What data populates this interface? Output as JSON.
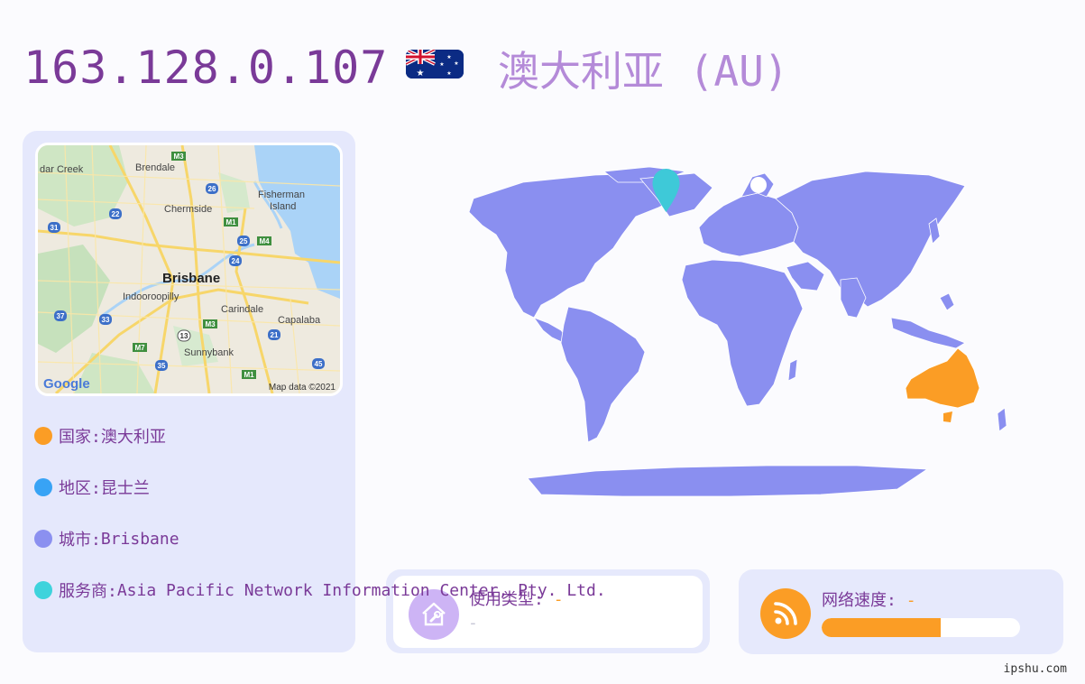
{
  "header": {
    "ip": "163.128.0.107",
    "country_title": "澳大利亚 (AU)"
  },
  "info": {
    "country": {
      "label": "国家: ",
      "value": "澳大利亚",
      "color": "#fb9d25"
    },
    "region": {
      "label": "地区: ",
      "value": "昆士兰",
      "color": "#38a3f5"
    },
    "city": {
      "label": "城市: ",
      "value": "Brisbane",
      "color": "#8b90f0"
    },
    "isp": {
      "label": "服务商: ",
      "value": "Asia Pacific Network Information Center, Pty. Ltd.",
      "color": "#3ed3dc"
    }
  },
  "map": {
    "places": [
      "dar Creek",
      "Brendale",
      "Fisherman",
      "Island",
      "Chermside",
      "Brisbane",
      "Indooroopilly",
      "Carindale",
      "Capalaba",
      "Sunnybank"
    ],
    "road_labels": [
      "M3",
      "26",
      "22",
      "M1",
      "31",
      "25",
      "M4",
      "24",
      "37",
      "33",
      "13",
      "M3",
      "21",
      "M7",
      "35",
      "45",
      "M1"
    ],
    "attribution": "Map data ©2021",
    "logo": "Google"
  },
  "usage": {
    "label": "使用类型: ",
    "value": "-",
    "sub": "-"
  },
  "speed": {
    "label": "网络速度: ",
    "value": "-",
    "progress": 0.6
  },
  "footer": "ipshu.com",
  "colors": {
    "land": "#8a8ff0",
    "highlight": "#fb9d25",
    "pin": "#3ec9d8",
    "title": "#7a3a98"
  }
}
